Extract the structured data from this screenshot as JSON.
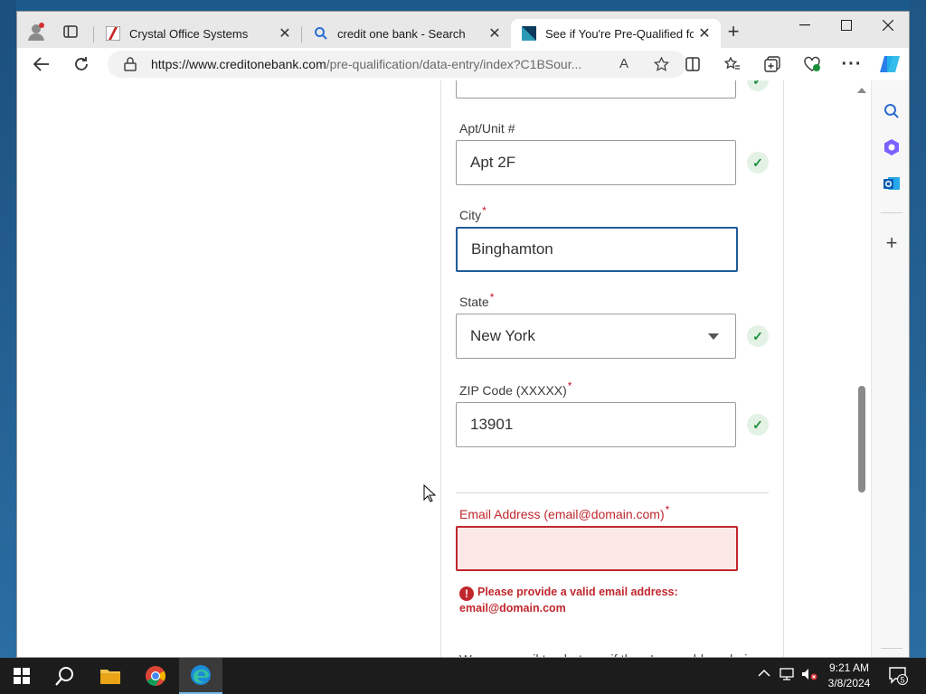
{
  "browser": {
    "tabs": [
      {
        "title": "Crystal Office Systems",
        "active": false
      },
      {
        "title": "credit one bank - Search",
        "active": false
      },
      {
        "title": "See if You're Pre-Qualified for a",
        "active": true
      }
    ],
    "url_host": "https://www.creditonebank.com",
    "url_path": "/pre-qualification/data-entry/index?C1BSour..."
  },
  "form": {
    "apt": {
      "label": "Apt/Unit #",
      "value": "Apt 2F"
    },
    "city": {
      "label": "City",
      "value": "Binghamton"
    },
    "state": {
      "label": "State",
      "value": "New York"
    },
    "zip": {
      "label": "ZIP Code (XXXXX)",
      "value": "13901"
    },
    "email": {
      "label": "Email Address (email@domain.com)",
      "value": "",
      "error": "Please provide a valid email address: email@domain.com"
    },
    "required_mark": "*",
    "info": "We use email to alert you if there's a problem during the application process, when we mail your new"
  },
  "taskbar": {
    "time": "9:21 AM",
    "date": "3/8/2024",
    "notification_count": "5"
  },
  "colors": {
    "focus_border": "#1f5c99",
    "error": "#c0272d",
    "success": "#1a8f3a",
    "brand_tab": "#0c3b5d"
  }
}
